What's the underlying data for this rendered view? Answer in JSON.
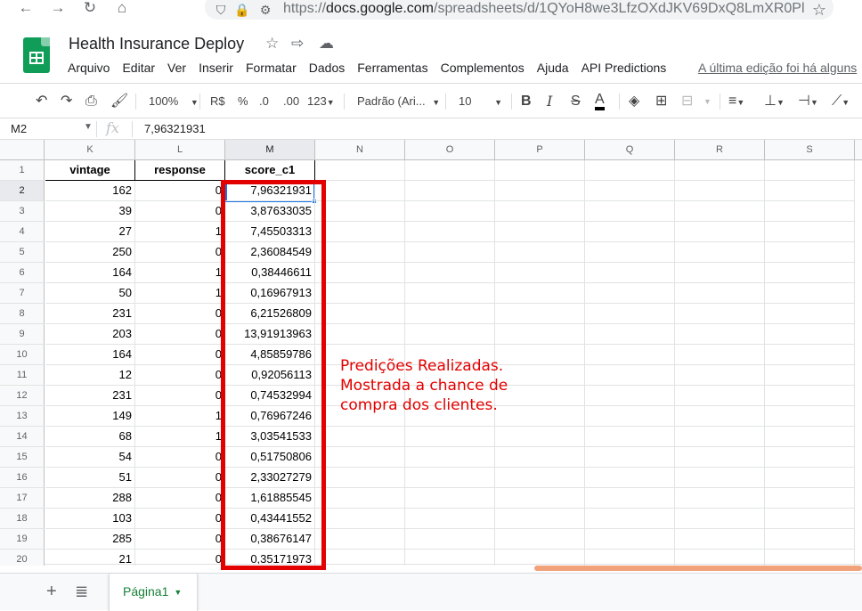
{
  "browser": {
    "url_scheme": "https://",
    "url_host": "docs.google.com",
    "url_path": "/spreadsheets/d/1QYoH8we3LfzOXdJKV69DxQ8LmXR0Pl"
  },
  "doc": {
    "title": "Health Insurance Deploy",
    "menu": [
      "Arquivo",
      "Editar",
      "Ver",
      "Inserir",
      "Formatar",
      "Dados",
      "Ferramentas",
      "Complementos",
      "Ajuda",
      "API Predictions"
    ],
    "last_edit": "A última edição foi há alguns"
  },
  "toolbar": {
    "zoom": "100%",
    "currency": "R$",
    "percent": "%",
    "dec_less": ".0",
    "dec_more": ".00",
    "more_formats": "123",
    "font": "Padrão (Ari...",
    "font_size": "10",
    "bold": "B",
    "italic": "I",
    "strike": "S",
    "text_color": "A"
  },
  "formula_bar": {
    "name_box": "M2",
    "fx": "fx",
    "value": "7,96321931"
  },
  "columns": [
    "K",
    "L",
    "M",
    "N",
    "O",
    "P",
    "Q",
    "R",
    "S"
  ],
  "selected_column": "M",
  "headers": {
    "K": "vintage",
    "L": "response",
    "M": "score_c1"
  },
  "rows": [
    {
      "n": "1"
    },
    {
      "n": "2",
      "vintage": "162",
      "response": "0",
      "score": "7,96321931"
    },
    {
      "n": "3",
      "vintage": "39",
      "response": "0",
      "score": "3,87633035"
    },
    {
      "n": "4",
      "vintage": "27",
      "response": "1",
      "score": "7,45503313"
    },
    {
      "n": "5",
      "vintage": "250",
      "response": "0",
      "score": "2,36084549"
    },
    {
      "n": "6",
      "vintage": "164",
      "response": "1",
      "score": "0,38446611"
    },
    {
      "n": "7",
      "vintage": "50",
      "response": "1",
      "score": "0,16967913"
    },
    {
      "n": "8",
      "vintage": "231",
      "response": "0",
      "score": "6,21526809"
    },
    {
      "n": "9",
      "vintage": "203",
      "response": "0",
      "score": "13,91913963"
    },
    {
      "n": "10",
      "vintage": "164",
      "response": "0",
      "score": "4,85859786"
    },
    {
      "n": "11",
      "vintage": "12",
      "response": "0",
      "score": "0,92056113"
    },
    {
      "n": "12",
      "vintage": "231",
      "response": "0",
      "score": "0,74532994"
    },
    {
      "n": "13",
      "vintage": "149",
      "response": "1",
      "score": "0,76967246"
    },
    {
      "n": "14",
      "vintage": "68",
      "response": "1",
      "score": "3,03541533"
    },
    {
      "n": "15",
      "vintage": "54",
      "response": "0",
      "score": "0,51750806"
    },
    {
      "n": "16",
      "vintage": "51",
      "response": "0",
      "score": "2,33027279"
    },
    {
      "n": "17",
      "vintage": "288",
      "response": "0",
      "score": "1,61885545"
    },
    {
      "n": "18",
      "vintage": "103",
      "response": "0",
      "score": "0,43441552"
    },
    {
      "n": "19",
      "vintage": "285",
      "response": "0",
      "score": "0,38676147"
    },
    {
      "n": "20",
      "vintage": "21",
      "response": "0",
      "score": "0,35171973"
    }
  ],
  "annotation": [
    "Predições Realizadas.",
    "Mostrada a chance de",
    "compra dos clientes."
  ],
  "sheet_tab": "Página1",
  "colors": {
    "highlight": "#e30000",
    "selection": "#1a73e8",
    "sheets_green": "#0f9d58"
  }
}
